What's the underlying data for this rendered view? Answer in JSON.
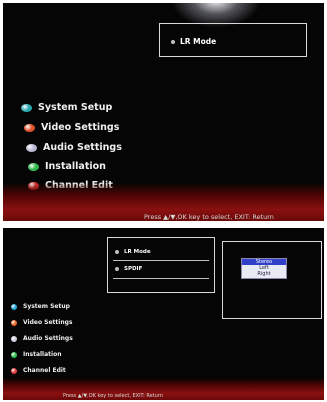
{
  "top": {
    "panel_item": "LR Mode",
    "menu": [
      {
        "label": "System Setup",
        "color": "#2aa8b0"
      },
      {
        "label": "Video Settings",
        "color": "#e0502a"
      },
      {
        "label": "Audio Settings",
        "color": "#b8b8d0"
      },
      {
        "label": "Installation",
        "color": "#2fb84a"
      },
      {
        "label": "Channel Edit",
        "color": "#d83030"
      }
    ],
    "status": "Press ▲/▼,OK key to select, EXIT: Return"
  },
  "bottom": {
    "panel_items": [
      "LR Mode",
      "SPDIF"
    ],
    "popup_options": [
      "Stereo",
      "Left",
      "Right"
    ],
    "popup_selected": "Stereo",
    "menu": [
      {
        "label": "System Setup",
        "color": "#2aa8d8"
      },
      {
        "label": "Video Settings",
        "color": "#e86a2a"
      },
      {
        "label": "Audio Settings",
        "color": "#d0d0e0"
      },
      {
        "label": "Installation",
        "color": "#36c050"
      },
      {
        "label": "Channel Edit",
        "color": "#e03a3a"
      }
    ],
    "status": "Press ▲/▼,OK key to select, EXIT: Return"
  }
}
